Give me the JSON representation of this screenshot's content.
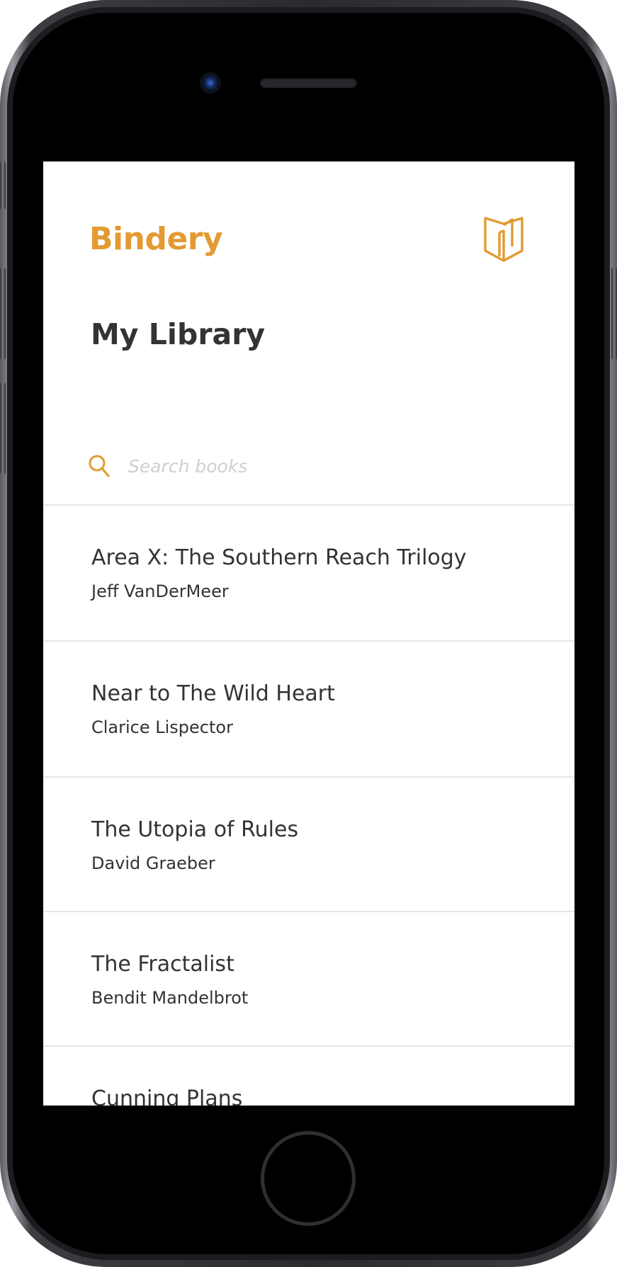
{
  "app": {
    "brand": "Bindery",
    "brand_color": "#E29B32",
    "logo_icon": "book-icon"
  },
  "page": {
    "title": "My Library"
  },
  "search": {
    "icon": "search-icon",
    "placeholder": "Search books",
    "value": ""
  },
  "books": [
    {
      "title": "Area X: The Southern Reach Trilogy",
      "author": "Jeff VanDerMeer"
    },
    {
      "title": "Near to The Wild Heart",
      "author": "Clarice Lispector"
    },
    {
      "title": "The Utopia of Rules",
      "author": "David Graeber"
    },
    {
      "title": "The Fractalist",
      "author": "Bendit Mandelbrot"
    },
    {
      "title": "Cunning Plans",
      "author": ""
    }
  ],
  "colors": {
    "accent": "#E29B32",
    "text": "#333333",
    "divider": "#E6E6E6",
    "placeholder": "#CFCFCF"
  }
}
